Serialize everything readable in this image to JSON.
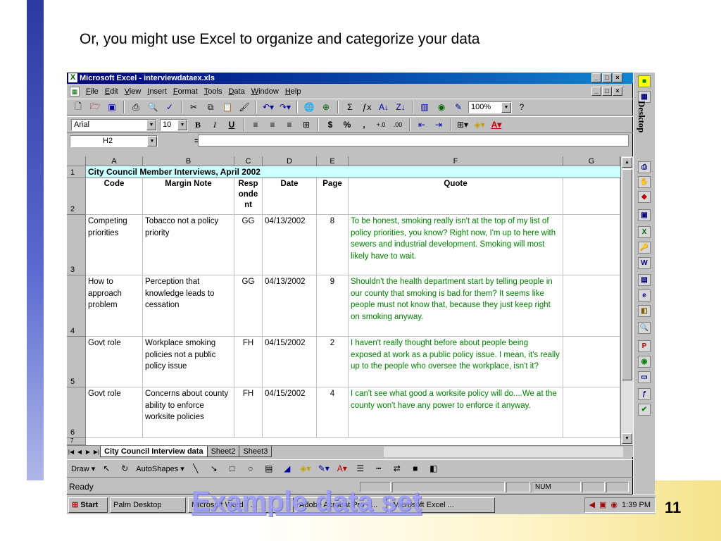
{
  "slide": {
    "heading": "Or, you might use Excel to organize and categorize your data",
    "caption": "Example data set",
    "number": "11"
  },
  "window": {
    "title": "Microsoft Excel - interviewdataex.xls",
    "menu": [
      "File",
      "Edit",
      "View",
      "Insert",
      "Format",
      "Tools",
      "Data",
      "Window",
      "Help"
    ],
    "zoom": "100%",
    "font": "Arial",
    "font_size": "10",
    "name_box": "H2",
    "formula_eq": "="
  },
  "grid": {
    "columns": [
      "A",
      "B",
      "C",
      "D",
      "E",
      "F",
      "G"
    ],
    "title": "City Council Member Interviews, April 2002",
    "headers": {
      "code": "Code",
      "note": "Margin Note",
      "respondent": "Resp onde nt",
      "date": "Date",
      "page": "Page",
      "quote": "Quote"
    },
    "row_numbers": [
      "1",
      "2",
      "3",
      "4",
      "5",
      "6",
      "7"
    ],
    "rows": [
      {
        "code": "Competing priorities",
        "note": "Tobacco not a policy priority",
        "respondent": "GG",
        "date": "04/13/2002",
        "page": "8",
        "quote": "To be honest, smoking really isn't at the top of my list of policy priorities, you know?  Right now, I'm up to here with sewers and industrial development. Smoking will most likely have to wait."
      },
      {
        "code": "How to approach problem",
        "note": "Perception that knowledge leads to cessation",
        "respondent": "GG",
        "date": "04/13/2002",
        "page": "9",
        "quote": "Shouldn't the health department start by telling people in our county that smoking is bad for them?  It seems like people must not know that, because they just keep right on smoking anyway."
      },
      {
        "code": "Govt role",
        "note": "Workplace smoking policies not a public policy issue",
        "respondent": "FH",
        "date": "04/15/2002",
        "page": "2",
        "quote": "I haven't really thought before about people being exposed at work as a public policy issue.  I mean, it's really up to the people who oversee the workplace, isn't it?"
      },
      {
        "code": "Govt role",
        "note": "Concerns about county ability to enforce worksite policies",
        "respondent": "FH",
        "date": "04/15/2002",
        "page": "4",
        "quote": "I can't see what good a worksite policy will do....We at the county won't have any power to enforce it anyway."
      }
    ]
  },
  "sheet_tabs": [
    "City Council Interview data",
    "Sheet2",
    "Sheet3"
  ],
  "draw_toolbar": {
    "draw": "Draw",
    "autoshapes": "AutoShapes"
  },
  "status": {
    "ready": "Ready",
    "num": "NUM"
  },
  "office_bar": {
    "label": "Desktop"
  },
  "taskbar": {
    "start": "Start",
    "tasks": [
      "Palm Desktop",
      "Microsoft Word - ...",
      "Adobe Acrobat Pro - ...",
      "Microsoft Excel ..."
    ],
    "clock": "1:39 PM"
  }
}
